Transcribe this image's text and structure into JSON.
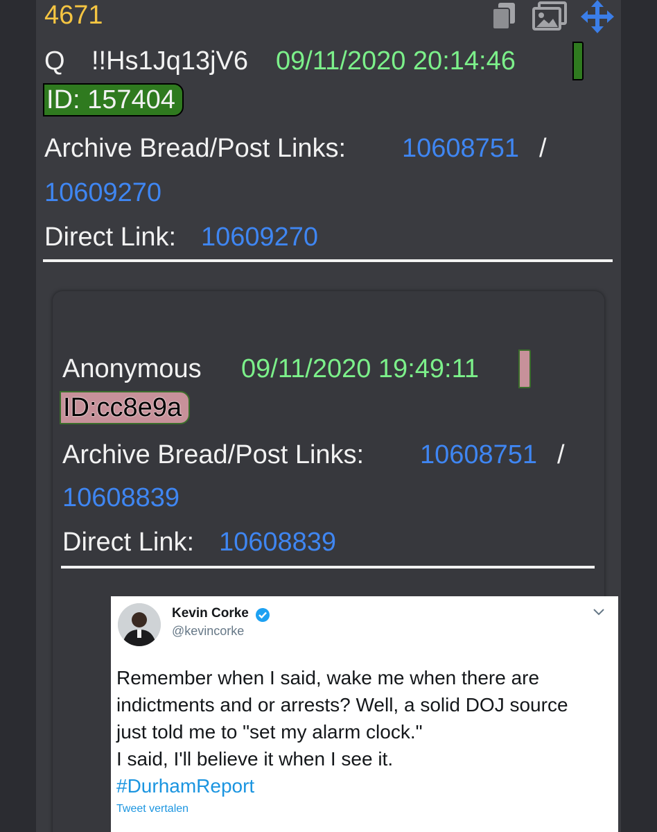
{
  "post": {
    "number": "4671",
    "author": "Q",
    "tripcode": "!!Hs1Jq13jV6",
    "timestamp": "09/11/2020 20:14:46",
    "id": "ID: 157404",
    "id_color": "#2f7a1f",
    "archive_label": "Archive Bread/Post Links:",
    "archive_bread": "10608751",
    "separator": "/",
    "archive_post": "10609270",
    "direct_label": "Direct Link:",
    "direct_link": "10609270"
  },
  "quoted_post": {
    "author": "Anonymous",
    "timestamp": "09/11/2020 19:49:11",
    "id": "ID:cc8e9a",
    "id_color": "#c7919a",
    "archive_label": "Archive Bread/Post Links:",
    "archive_bread": "10608751",
    "separator": "/",
    "archive_post": "10608839",
    "direct_label": "Direct Link:",
    "direct_link": "10608839"
  },
  "tweet": {
    "name": "Kevin Corke",
    "handle": "@kevincorke",
    "verified": true,
    "lines": [
      "Remember when I said, wake me when there are",
      "indictments and or arrests?  Well, a solid DOJ source",
      "just told me to \"set my alarm clock.\"",
      "I said, I'll believe it when I see it."
    ],
    "hashtag": "#DurhamReport",
    "translate": "Tweet vertalen"
  },
  "toolbar_icons": [
    "copy-icon",
    "images-icon",
    "move-icon"
  ],
  "colors": {
    "number": "#f5c542",
    "timestamp": "#7cf08a",
    "link": "#3f86f2",
    "text": "#f2f2f2"
  }
}
